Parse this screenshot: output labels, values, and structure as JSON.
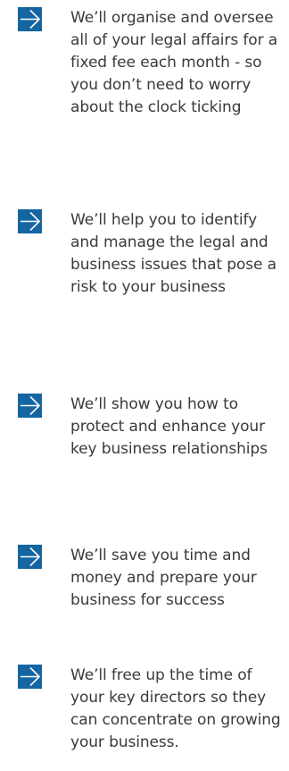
{
  "benefits": [
    {
      "icon": "arrow-right-icon",
      "text": "We’ll organise and oversee all of your legal affairs for a fixed fee each month - so you don’t need to worry about the clock ticking"
    },
    {
      "icon": "arrow-right-icon",
      "text": "We’ll help you to identify and manage the legal and business issues that pose a risk to your business"
    },
    {
      "icon": "arrow-right-icon",
      "text": "We’ll show you how to protect and enhance your key business relationships"
    },
    {
      "icon": "arrow-right-icon",
      "text": "We’ll save you time and money and prepare your business for success"
    },
    {
      "icon": "arrow-right-icon",
      "text": "We’ll free up the time of your key directors so they can concentrate on growing your business."
    }
  ],
  "colors": {
    "icon_fill": "#1565a0",
    "icon_stroke": "#ffffff",
    "text": "#3a3a3a"
  }
}
